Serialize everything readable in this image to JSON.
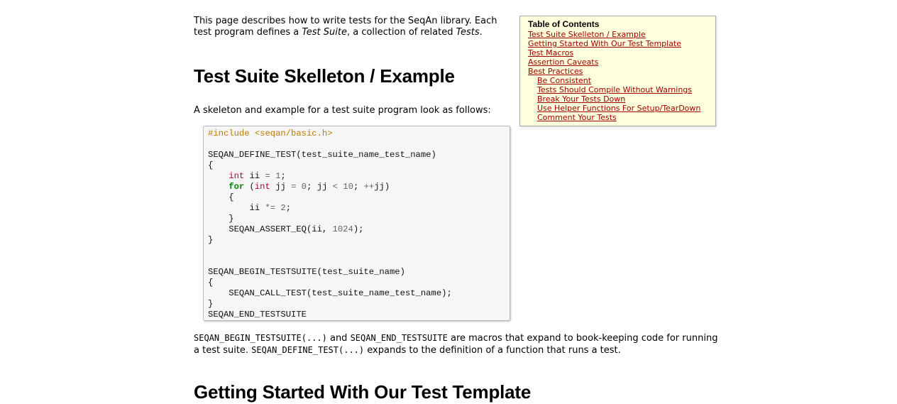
{
  "intro": {
    "text_1": "This page describes how to write tests for the SeqAn library. Each test program defines a ",
    "term_1": "Test Suite",
    "text_2": ", a collection of related ",
    "term_2": "Tests",
    "text_3": "."
  },
  "section_1": {
    "heading": "Test Suite Skelleton / Example",
    "description": "A skeleton and example for a test suite program look as follows:"
  },
  "code": {
    "include_line": "#include <seqan/basic.h>",
    "define_test": "SEQAN_DEFINE_TEST(test_suite_name_test_name)",
    "int_kw": "int",
    "for_kw": "for",
    "num_1": "1",
    "num_0": "0",
    "num_10": "10",
    "num_2": "2",
    "num_1024": "1024",
    "assert_call": "SEQAN_ASSERT_EQ(ii, ",
    "begin_testsuite": "SEQAN_BEGIN_TESTSUITE(test_suite_name)",
    "call_test": "SEQAN_CALL_TEST(test_suite_name_test_name);",
    "end_testsuite": "SEQAN_END_TESTSUITE"
  },
  "macros_paragraph": {
    "code_1": "SEQAN_BEGIN_TESTSUITE(...)",
    "text_1": " and ",
    "code_2": "SEQAN_END_TESTSUITE",
    "text_2": " are macros that expand to book-keeping code for running a test suite. ",
    "code_3": "SEQAN_DEFINE_TEST(...)",
    "text_3": " expands to the definition of a function that runs a test."
  },
  "section_2": {
    "heading": "Getting Started With Our Test Template"
  },
  "toc": {
    "title": "Table of Contents",
    "items": [
      {
        "label": "Test Suite Skelleton / Example",
        "level": 1
      },
      {
        "label": "Getting Started With Our Test Template",
        "level": 1
      },
      {
        "label": "Test Macros",
        "level": 1
      },
      {
        "label": "Assertion Caveats",
        "level": 1
      },
      {
        "label": "Best Practices",
        "level": 1
      },
      {
        "label": "Be Consistent",
        "level": 2
      },
      {
        "label": "Tests Should Compile Without Warnings",
        "level": 2
      },
      {
        "label": "Break Your Tests Down",
        "level": 2
      },
      {
        "label": "Use Helper Functions For Setup/TearDown",
        "level": 2
      },
      {
        "label": "Comment Your Tests",
        "level": 2
      }
    ],
    "link_color": "#a00000",
    "background": "#ffffdd"
  }
}
